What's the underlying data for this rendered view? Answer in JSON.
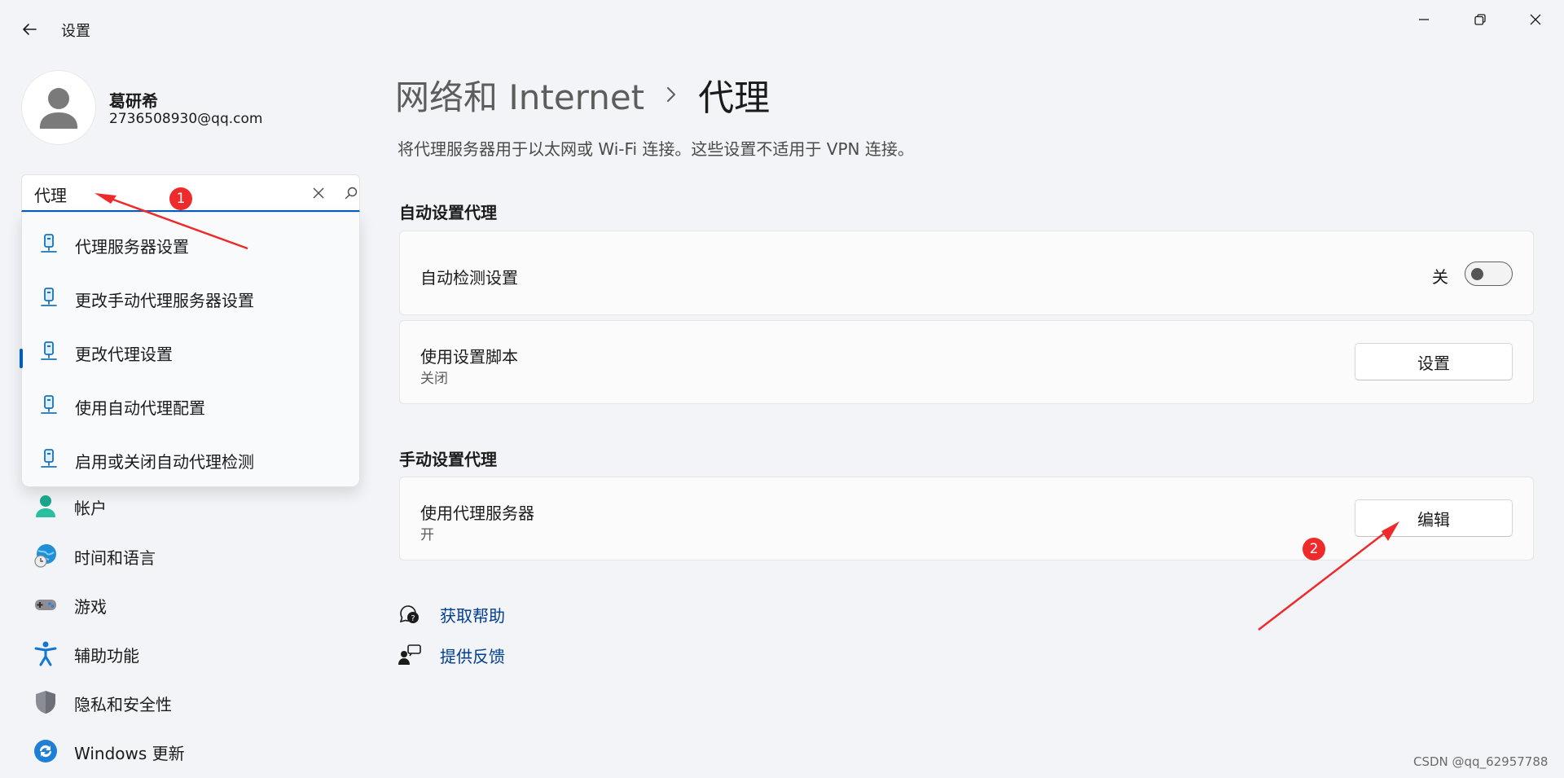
{
  "window": {
    "title": "设置"
  },
  "profile": {
    "name": "葛研希",
    "email": "2736508930@qq.com"
  },
  "search": {
    "value": "代理",
    "suggestions": [
      {
        "label": "代理服务器设置"
      },
      {
        "label": "更改手动代理服务器设置"
      },
      {
        "label": "更改代理设置"
      },
      {
        "label": "使用自动代理配置"
      },
      {
        "label": "启用或关闭自动代理检测"
      }
    ]
  },
  "sidebar": {
    "items": [
      {
        "label": "帐户",
        "icon": "account-icon"
      },
      {
        "label": "时间和语言",
        "icon": "time-language-icon"
      },
      {
        "label": "游戏",
        "icon": "gaming-icon"
      },
      {
        "label": "辅助功能",
        "icon": "accessibility-icon"
      },
      {
        "label": "隐私和安全性",
        "icon": "shield-icon"
      },
      {
        "label": "Windows 更新",
        "icon": "windows-update-icon"
      }
    ]
  },
  "main": {
    "breadcrumb": {
      "parent": "网络和 Internet",
      "current": "代理"
    },
    "description": "将代理服务器用于以太网或 Wi-Fi 连接。这些设置不适用于 VPN 连接。",
    "auto_section": {
      "title": "自动设置代理",
      "detect": {
        "label": "自动检测设置",
        "state_label": "关",
        "on": false
      },
      "script": {
        "label": "使用设置脚本",
        "sub": "关闭",
        "button": "设置"
      }
    },
    "manual_section": {
      "title": "手动设置代理",
      "proxy": {
        "label": "使用代理服务器",
        "sub": "开",
        "button": "编辑"
      }
    },
    "links": {
      "help": "获取帮助",
      "feedback": "提供反馈"
    }
  },
  "annotations": {
    "badge1": "1",
    "badge2": "2",
    "color": "#ee2a2a"
  },
  "watermark": "CSDN @qq_62957788",
  "colors": {
    "accent": "#005fb8",
    "link": "#003e92",
    "background": "#f3f4f7"
  }
}
